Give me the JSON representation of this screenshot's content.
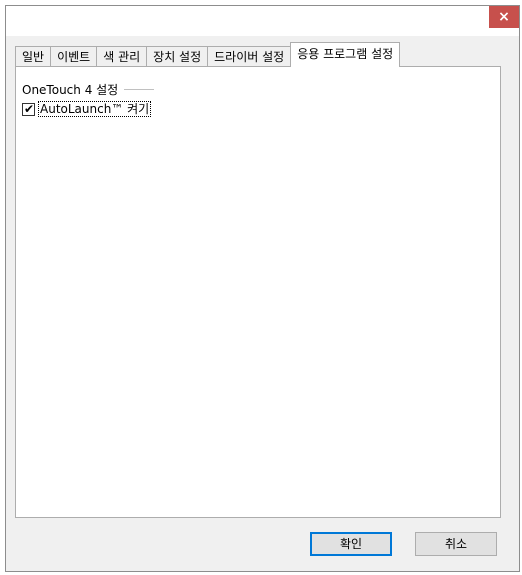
{
  "window": {
    "close_symbol": "×",
    "close_color": "#c7504c"
  },
  "tabs": [
    {
      "label": "일반",
      "active": false
    },
    {
      "label": "이벤트",
      "active": false
    },
    {
      "label": "색 관리",
      "active": false
    },
    {
      "label": "장치 설정",
      "active": false
    },
    {
      "label": "드라이버 설정",
      "active": false
    },
    {
      "label": "응용 프로그램 설정",
      "active": true
    }
  ],
  "panel": {
    "group_title": "OneTouch 4 설정",
    "checkbox": {
      "label": "AutoLaunch™ 켜기",
      "checked": true,
      "check_symbol": "✔"
    }
  },
  "buttons": {
    "ok_label": "확인",
    "cancel_label": "취소"
  },
  "colors": {
    "accent": "#0078d7",
    "dialog_bg": "#f0f0f0",
    "panel_bg": "#ffffff"
  }
}
